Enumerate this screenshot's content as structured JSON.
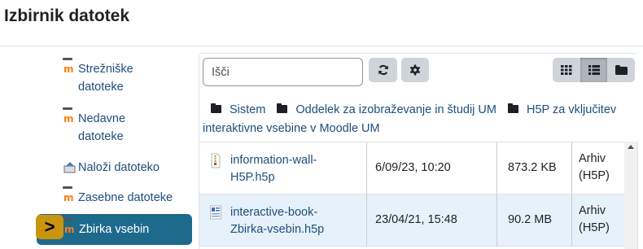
{
  "dialog": {
    "title": "Izbirnik datotek"
  },
  "sidebar": {
    "items": [
      {
        "label": "Strežniške datoteke",
        "icon": "moodle-icon"
      },
      {
        "label": "Nedavne datoteke",
        "icon": "moodle-icon"
      },
      {
        "label": "Naloži datoteko",
        "icon": "upload-icon"
      },
      {
        "label": "Zasebne datoteke",
        "icon": "moodle-icon"
      },
      {
        "label": "Zbirka vsebin",
        "icon": "moodle-icon",
        "active": true
      }
    ],
    "active_marker": ">"
  },
  "toolbar": {
    "search_placeholder": "Išči",
    "search_value": "",
    "buttons": [
      "refresh-icon",
      "settings-icon"
    ],
    "views": [
      {
        "icon": "grid-icon",
        "pressed": false
      },
      {
        "icon": "list-icon",
        "pressed": true
      },
      {
        "icon": "folder-icon",
        "pressed": false
      }
    ]
  },
  "breadcrumb": [
    "Sistem",
    "Oddelek za izobraževanje in študij UM",
    "H5P za vključitev interaktivne vsebine v Moodle UM"
  ],
  "files": [
    {
      "name": "information-wall-H5P.h5p",
      "name_line1": "information-wall-",
      "name_line2": "H5P.h5p",
      "date": "6/09/23, 10:20",
      "size": "873.2 KB",
      "type_line1": "Arhiv",
      "type_line2": "(H5P)",
      "icon": "archive-file-icon"
    },
    {
      "name": "interactive-book-Zbirka-vsebin.h5p",
      "name_line1": "interactive-book-",
      "name_line2": "Zbirka-vsebin.h5p",
      "date": "23/04/21, 15:48",
      "size": "90.2 MB",
      "type_line1": "Arhiv",
      "type_line2": "(H5P)",
      "icon": "h5p-file-icon"
    }
  ],
  "colors": {
    "accent": "#1e6a8d",
    "marker": "#c9950e",
    "link": "#1e4e7c",
    "selected_row": "#e7f1fa"
  }
}
